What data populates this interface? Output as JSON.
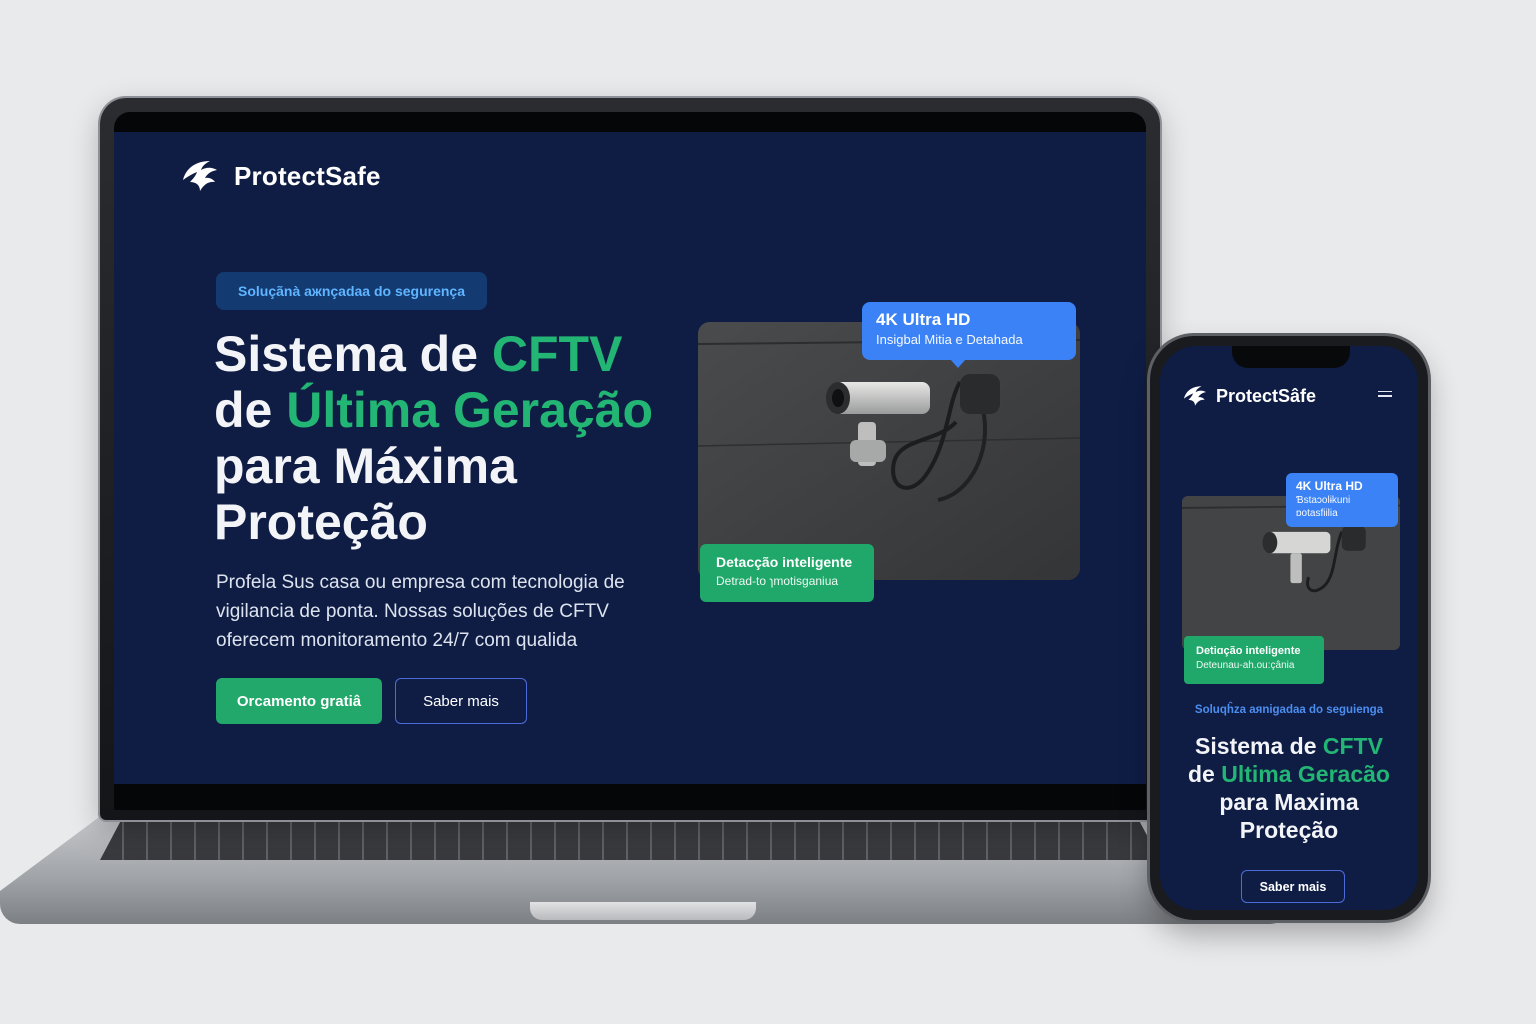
{
  "laptop": {
    "brand": {
      "name": "ProtectSafe",
      "logo_icon": "shield-wing-icon"
    },
    "badge": "Soluçãnà aжnçadaa do segurença",
    "headline": {
      "line1_plain": "Sistema de ",
      "line1_accent": "CFTV",
      "line2_plain": "de ",
      "line2_accent": "Última Geração",
      "line3": "para Máxima",
      "line4": "Proteção"
    },
    "subtext": "Profela Sus casa ou empresa com tecnologia de vigilancia de ponta. Nossas soluções de CFTV oferecem monitoramento 24/7 com qualida",
    "buttons": {
      "primary": "Orcamento gratiâ",
      "secondary": "Saber mais"
    },
    "callout_blue": {
      "title": "4K Ultra HD",
      "subtitle": "Insigbal Mitia e Detahada"
    },
    "callout_green": {
      "title": "Detacção inteligente",
      "subtitle": "Detrad-to ɿmotisganiua"
    }
  },
  "phone": {
    "brand": {
      "name": "ProtectSâfe",
      "logo_icon": "shield-wing-icon",
      "menu_icon": "hamburger-menu-icon"
    },
    "callout_blue": {
      "title": "4K Ultra HD",
      "subtitle": "Ɓstaɔolɨkuni ɒotasfiilia"
    },
    "callout_green": {
      "title": "Detiɑção inteligente",
      "subtitle": "Deteunau-ah.ou:çânia"
    },
    "badge": "Soluqĥza aяnigadaa do seguienɡa",
    "headline": {
      "line1_plain": "Sistema de ",
      "line1_accent": "CFTV",
      "line2_plain": "de ",
      "line2_accent": "Ultima Geracão",
      "line3": "para Maxima",
      "line4": "Proteção"
    },
    "button": "Saber mais"
  },
  "colors": {
    "background": "#0f1d45",
    "accent_green": "#22b573",
    "accent_blue": "#3b82f6",
    "badge_text": "#5fb5ff"
  }
}
